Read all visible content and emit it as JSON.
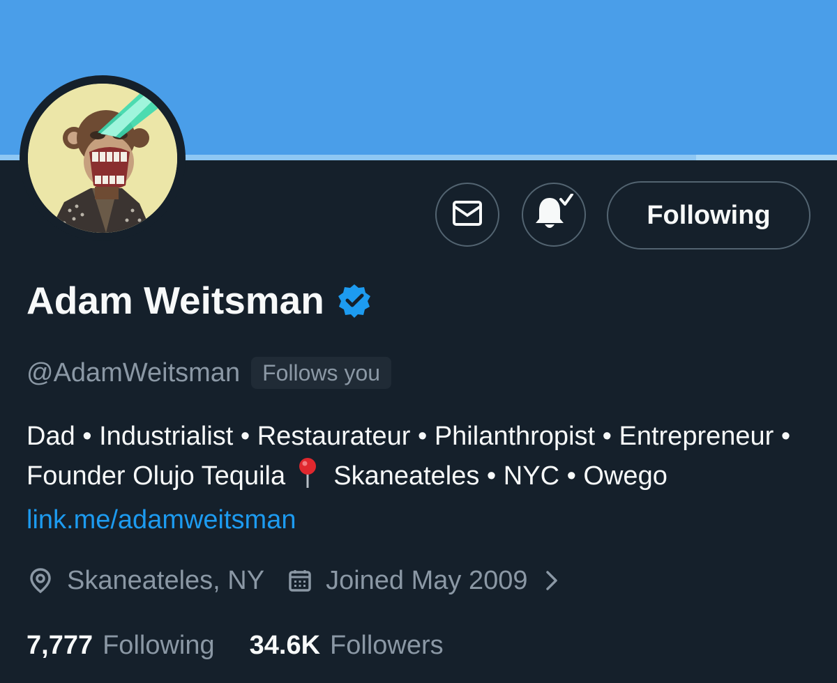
{
  "profile": {
    "display_name": "Adam Weitsman",
    "handle": "@AdamWeitsman",
    "follows_you": "Follows you",
    "verified_icon": "verified-badge-icon",
    "avatar": "bored-ape-avatar"
  },
  "actions": {
    "message_icon": "envelope-icon",
    "notify_icon": "bell-check-icon",
    "follow_label": "Following"
  },
  "bio": {
    "line_before_pin": "Dad • Industrialist • Restaurateur • Philanthropist • Entrepreneur • Founder Olujo Tequila",
    "pin_icon": "round-pushpin-icon",
    "line_after_pin": "Skaneateles • NYC • Owego",
    "link_text": "link.me/adamweitsman"
  },
  "meta": {
    "location": "Skaneateles, NY",
    "joined": "Joined May 2009"
  },
  "stats": {
    "following_count": "7,777",
    "following_label": "Following",
    "followers_count": "34.6K",
    "followers_label": "Followers"
  },
  "colors": {
    "background": "#15202b",
    "banner": "#4a9ee9",
    "accent": "#1d9bf0",
    "secondary_text": "#8b98a5",
    "primary_text": "#f7f9f9"
  }
}
